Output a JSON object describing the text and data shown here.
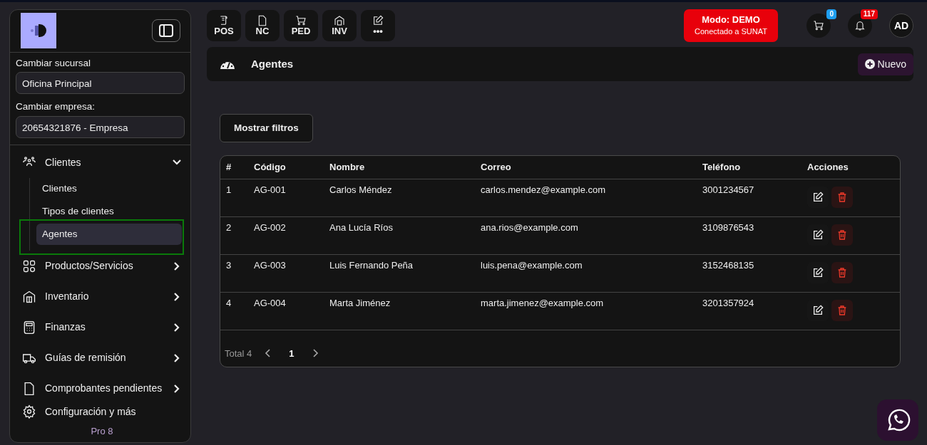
{
  "sidebar": {
    "branch_label": "Cambiar sucursal",
    "branch_value": "Oficina Principal",
    "company_label": "Cambiar empresa:",
    "company_value": "20654321876 - Empresa",
    "menu": [
      {
        "label": "Clientes",
        "expanded": true,
        "children": [
          {
            "label": "Clientes",
            "selected": false
          },
          {
            "label": "Tipos de clientes",
            "selected": false
          },
          {
            "label": "Agentes",
            "selected": true
          }
        ]
      },
      {
        "label": "Productos/Servicios",
        "expanded": false
      },
      {
        "label": "Inventario",
        "expanded": false
      },
      {
        "label": "Finanzas",
        "expanded": false
      },
      {
        "label": "Guías de remisión",
        "expanded": false
      },
      {
        "label": "Comprobantes pendientes",
        "expanded": false
      }
    ],
    "settings": "Configuración y más",
    "version": "Pro 8"
  },
  "quick_actions": [
    {
      "label": "POS"
    },
    {
      "label": "NC"
    },
    {
      "label": "PED"
    },
    {
      "label": "INV"
    },
    {
      "label": "•••"
    }
  ],
  "mode_badge": {
    "title": "Modo: DEMO",
    "subtitle": "Conectado a SUNAT"
  },
  "cart_count": "0",
  "notification_count": "117",
  "avatar": "AD",
  "page_title": "Agentes",
  "new_button": "Nuevo",
  "filters_button": "Mostrar filtros",
  "table": {
    "columns": [
      "#",
      "Código",
      "Nombre",
      "Correo",
      "Teléfono",
      "Acciones"
    ],
    "rows": [
      [
        "1",
        "AG-001",
        "Carlos Méndez",
        "carlos.mendez@example.com",
        "3001234567"
      ],
      [
        "2",
        "AG-002",
        "Ana Lucía Ríos",
        "ana.rios@example.com",
        "3109876543"
      ],
      [
        "3",
        "AG-003",
        "Luis Fernando Peña",
        "luis.pena@example.com",
        "3152468135"
      ],
      [
        "4",
        "AG-004",
        "Marta Jiménez",
        "marta.jimenez@example.com",
        "3201357924"
      ]
    ]
  },
  "pagination": {
    "total": "Total 4",
    "pages": [
      {
        "label": "1",
        "selected": true
      }
    ]
  }
}
